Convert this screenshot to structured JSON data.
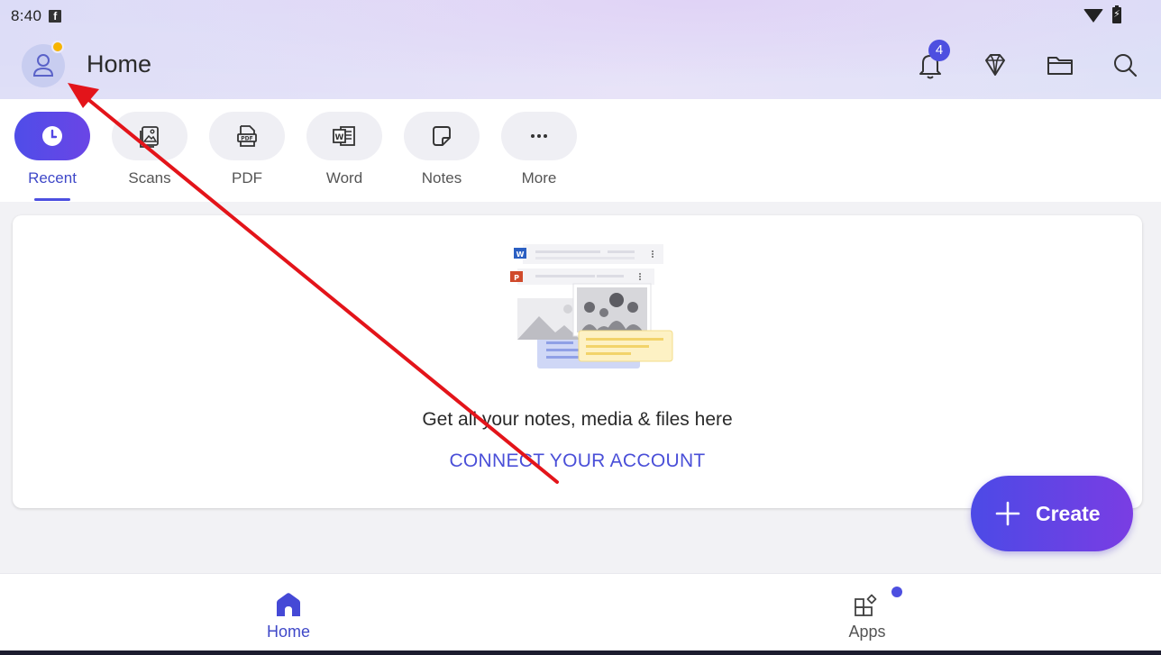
{
  "status_bar": {
    "time": "8:40",
    "app_notification_icon": "facebook-icon"
  },
  "header": {
    "title": "Home",
    "notification_count": "4",
    "accent_color": "#4d4fe0",
    "avatar_badge_color": "#f6b400"
  },
  "tabs": [
    {
      "label": "Recent",
      "icon": "clock-icon",
      "active": true
    },
    {
      "label": "Scans",
      "icon": "image-icon"
    },
    {
      "label": "PDF",
      "icon": "pdf-icon"
    },
    {
      "label": "Word",
      "icon": "word-icon"
    },
    {
      "label": "Notes",
      "icon": "note-icon"
    },
    {
      "label": "More",
      "icon": "more-icon"
    }
  ],
  "empty_state": {
    "message": "Get all your notes, media & files here",
    "link": "CONNECT YOUR ACCOUNT"
  },
  "fab": {
    "label": "Create"
  },
  "bottom_nav": {
    "home": "Home",
    "apps": "Apps"
  }
}
